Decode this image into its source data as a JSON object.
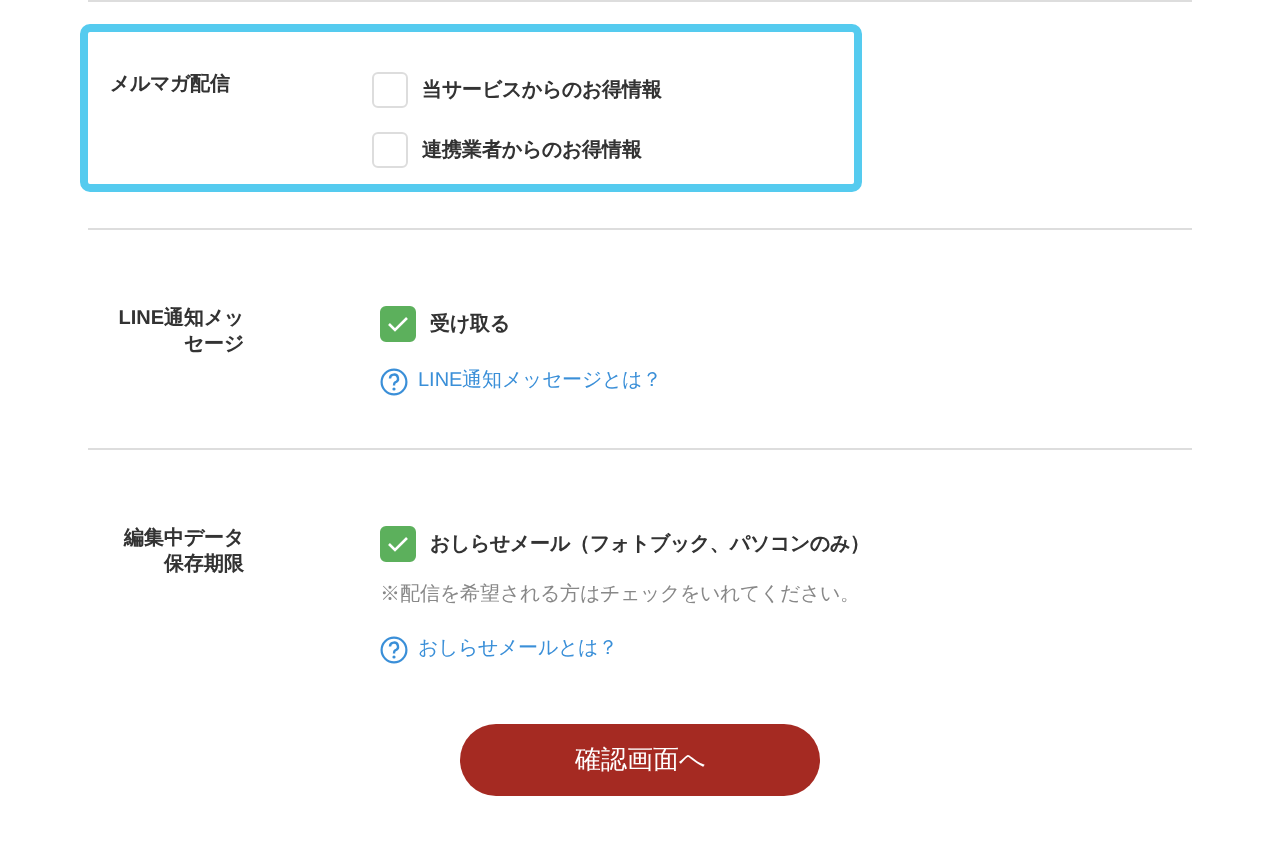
{
  "sections": [
    {
      "label": "メルマガ配信",
      "highlighted": true,
      "options": [
        {
          "text": "当サービスからのお得情報",
          "checked": false
        },
        {
          "text": "連携業者からのお得情報",
          "checked": false
        }
      ]
    },
    {
      "label": "LINE通知メッセージ",
      "highlighted": false,
      "options": [
        {
          "text": "受け取る",
          "checked": true
        }
      ],
      "help_link": "LINE通知メッセージとは？"
    },
    {
      "label": "編集中データ保存期限",
      "highlighted": false,
      "options": [
        {
          "text": "おしらせメール（フォトブック、パソコンのみ）",
          "checked": true
        }
      ],
      "note": "※配信を希望される方はチェックをいれてください。",
      "help_link": "おしらせメールとは？"
    }
  ],
  "submit_button": "確認画面へ"
}
